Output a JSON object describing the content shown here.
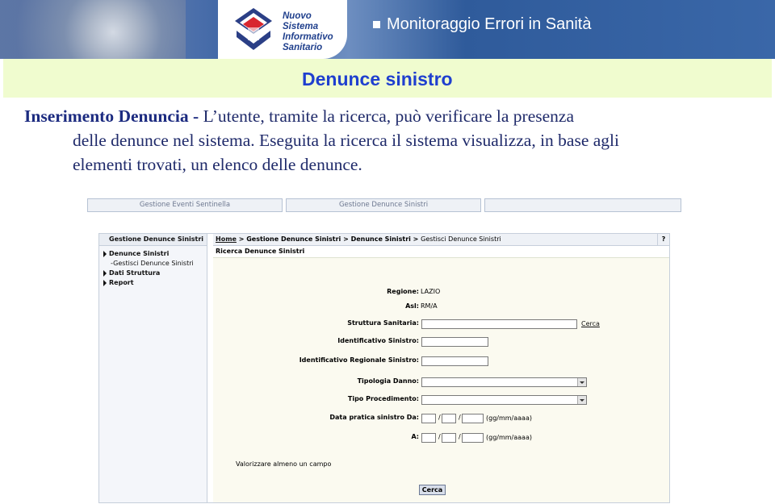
{
  "banner": {
    "logo_lines": [
      "Nuovo",
      "Sistema",
      "Informativo",
      "Sanitario"
    ],
    "title": "Monitoraggio Errori in Sanità"
  },
  "slide": {
    "heading": "Denunce sinistro",
    "para_bold": "Inserimento Denuncia",
    "para_dash": " - ",
    "para_line1": "L’utente, tramite la ricerca, può verificare  la presenza",
    "para_line2": "delle denunce nel sistema. Eseguita la ricerca il sistema visualizza, in base agli",
    "para_line3": "elementi trovati, un elenco delle denunce."
  },
  "tabs": [
    "Gestione Eventi Sentinella",
    "Gestione Denunce Sinistri",
    ""
  ],
  "sidebar": {
    "title": "Gestione Denunce Sinistri",
    "items": [
      {
        "label": "Denunce Sinistri"
      },
      {
        "label": "-Gestisci Denunce Sinistri"
      },
      {
        "label": "Dati Struttura"
      },
      {
        "label": "Report"
      }
    ]
  },
  "breadcrumb": {
    "home": "Home",
    "sep": " > ",
    "p1": "Gestione Denunce Sinistri",
    "p2": "Denunce Sinistri",
    "p3": "Gestisci Denunce Sinistri",
    "help": "?"
  },
  "form": {
    "section_title": "Ricerca Denunce Sinistri",
    "regione_label": "Regione:",
    "regione_value": "LAZIO",
    "asl_label": "Asl:",
    "asl_value": "RM/A",
    "struttura_label": "Struttura Sanitaria:",
    "struttura_link": "Cerca",
    "ident_label": "Identificativo Sinistro:",
    "ident_reg_label": "Identificativo Regionale Sinistro:",
    "tipologia_label": "Tipologia Danno:",
    "tipo_proc_label": "Tipo Procedimento:",
    "data_da_label": "Data pratica sinistro Da:",
    "data_a_label": "A:",
    "slash": "/",
    "date_hint": "(gg/mm/aaaa)",
    "note": "Valorizzare almeno un campo",
    "button": "Cerca"
  }
}
